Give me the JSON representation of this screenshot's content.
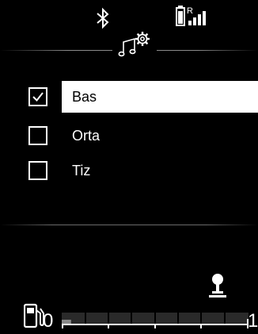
{
  "status_bar": {
    "bluetooth_icon": "bluetooth-icon",
    "signal_icon": "battery-roaming-signal-icon",
    "roaming_letter": "R"
  },
  "header": {
    "icon": "music-settings-icon"
  },
  "options": [
    {
      "label": "Bas",
      "checked": true,
      "selected": true
    },
    {
      "label": "Orta",
      "checked": false,
      "selected": false
    },
    {
      "label": "Tiz",
      "checked": false,
      "selected": false
    }
  ],
  "bottom": {
    "gear_icon": "gear-shift-icon",
    "fuel_icon": "fuel-pump-icon",
    "fuel_gauge": {
      "min_label": "0",
      "max_label": "1",
      "level": 0.05
    }
  },
  "colors": {
    "background": "#000000",
    "text": "#ffffff",
    "selected_background": "#ffffff",
    "selected_text": "#000000",
    "gauge_track": "#333333"
  }
}
